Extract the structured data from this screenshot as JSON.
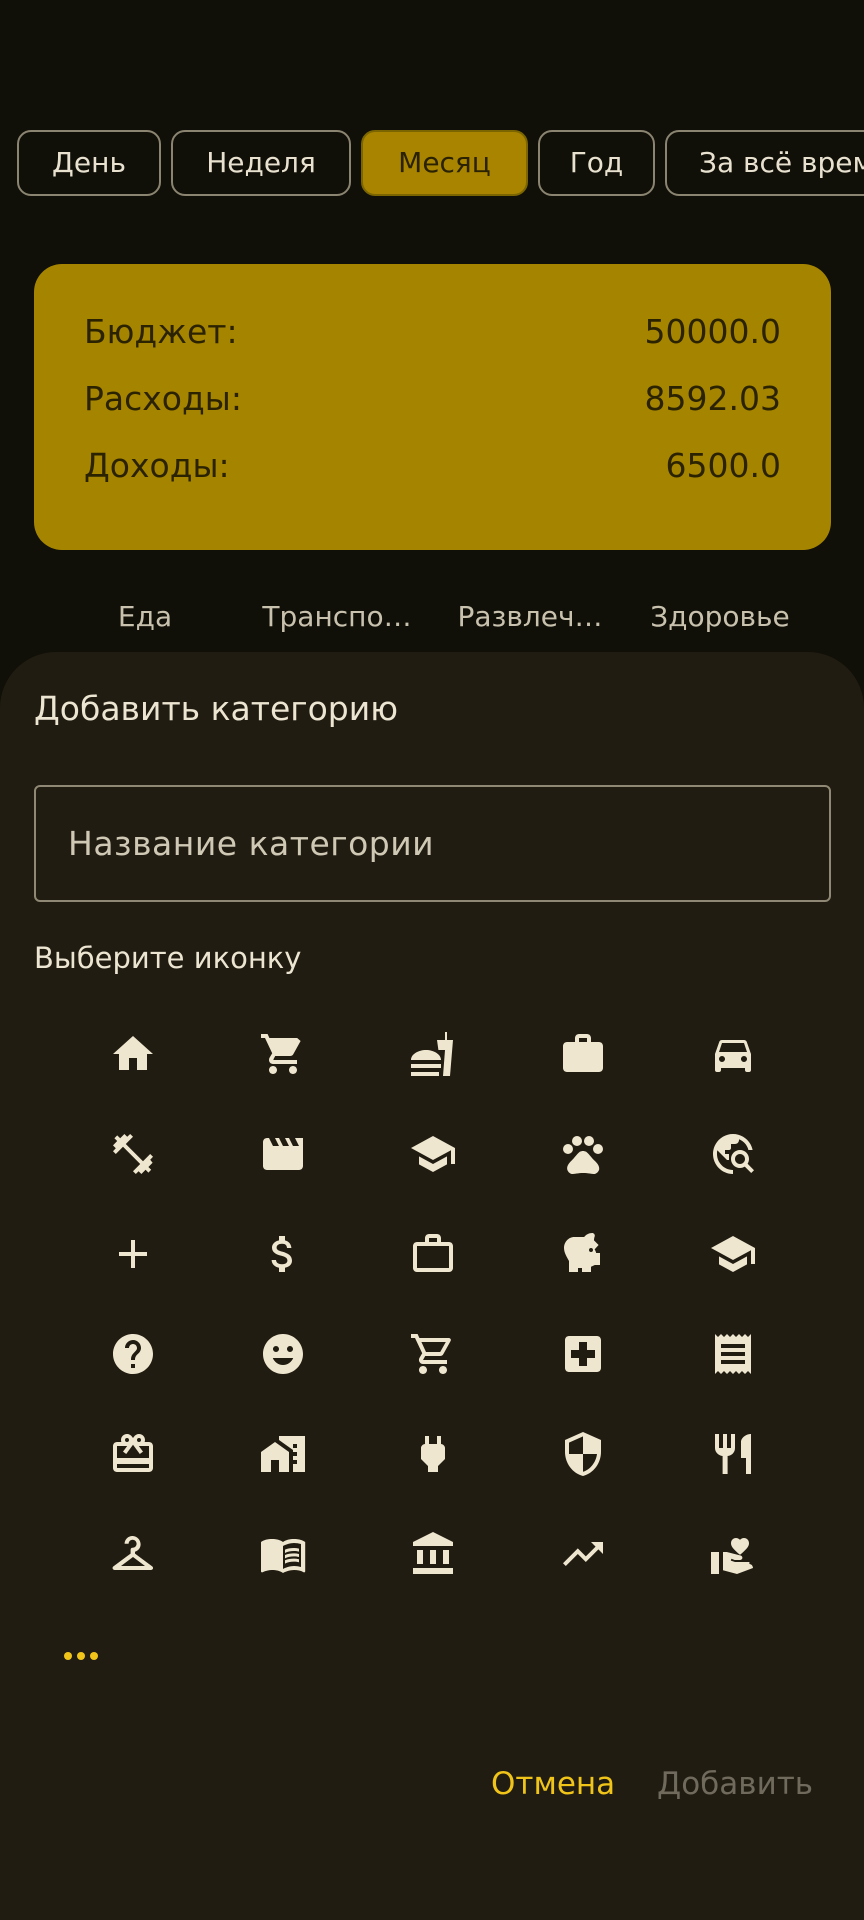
{
  "period_tabs": [
    {
      "label": "День",
      "selected": false
    },
    {
      "label": "Неделя",
      "selected": false
    },
    {
      "label": "Месяц",
      "selected": true
    },
    {
      "label": "Год",
      "selected": false
    },
    {
      "label": "За всё время",
      "selected": false
    }
  ],
  "summary": {
    "budget_label": "Бюджет:",
    "budget_value": "50000.0",
    "expenses_label": "Расходы:",
    "expenses_value": "8592.03",
    "income_label": "Доходы:",
    "income_value": "6500.0"
  },
  "categories": [
    "Еда",
    "Транспо…",
    "Развлеч…",
    "Здоровье"
  ],
  "dialog": {
    "title": "Добавить категорию",
    "name_placeholder": "Название категории",
    "icon_section_label": "Выберите иконку",
    "icons": [
      "home-icon",
      "shopping-cart-icon",
      "fastfood-icon",
      "work-icon",
      "car-icon",
      "fitness-icon",
      "movie-icon",
      "school-icon",
      "pets-icon",
      "travel-explore-icon",
      "add-icon",
      "dollar-icon",
      "work-outline-icon",
      "savings-icon",
      "school-icon-2",
      "help-icon",
      "emoji-icon",
      "shopping-cart-outline-icon",
      "medical-icon",
      "receipt-icon",
      "redeem-icon",
      "home-work-icon",
      "power-plug-icon",
      "security-icon",
      "restaurant-icon",
      "checkroom-icon",
      "menu-book-icon",
      "bank-icon",
      "trending-up-icon",
      "volunteer-icon"
    ],
    "more_icon": "more-horizontal-icon",
    "cancel_label": "Отмена",
    "add_label": "Добавить"
  },
  "colors": {
    "background": "#100f08",
    "accent": "#a58400",
    "sheet": "#201c11",
    "action": "#f0c419",
    "disabled": "#6f6a5c"
  }
}
